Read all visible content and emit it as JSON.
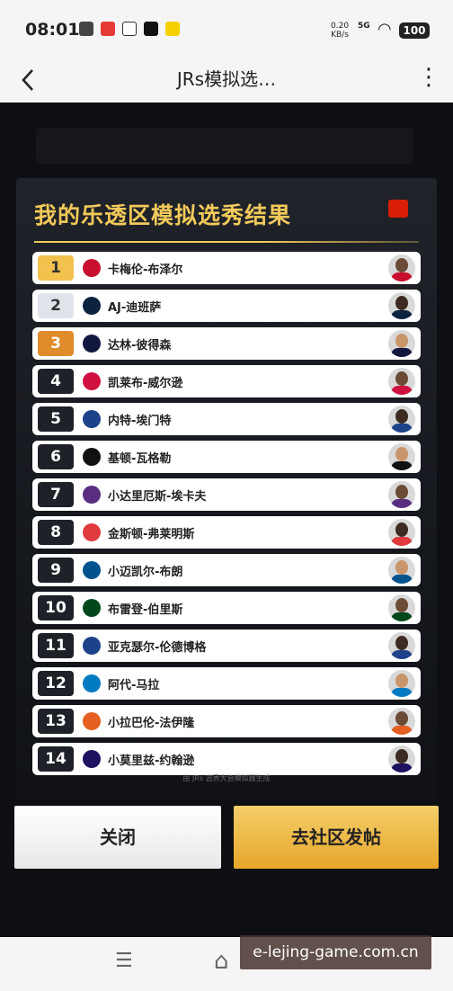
{
  "status_bar": {
    "time": "08:01",
    "net_speed_value": "0.20",
    "net_speed_unit": "KB/s",
    "signal": "5G",
    "battery": "100"
  },
  "nav": {
    "back_icon": "chevron-left-icon",
    "title": "JRs模拟选…",
    "more_icon": "more-vertical-icon"
  },
  "card": {
    "title": "我的乐透区模拟选秀结果",
    "footer_note": "由 JRs 选秀大会模拟器生成"
  },
  "picks": [
    {
      "num": "1",
      "name": "卡梅伦-布泽尔",
      "num_color": "#f2c14e",
      "num_text_color": "#333333",
      "team_color": "#c8102e"
    },
    {
      "num": "2",
      "name": "AJ-迪班萨",
      "num_color": "#dfe3ea",
      "num_text_color": "#333333",
      "team_color": "#0c2340"
    },
    {
      "num": "3",
      "name": "达林-彼得森",
      "num_color": "#e08b2c",
      "num_text_color": "#ffffff",
      "team_color": "#12173f"
    },
    {
      "num": "4",
      "name": "凯莱布-威尔逊",
      "num_color": "#1e2228",
      "num_text_color": "#ffffff",
      "team_color": "#ce1141"
    },
    {
      "num": "5",
      "name": "内特-埃门特",
      "num_color": "#1e2228",
      "num_text_color": "#ffffff",
      "team_color": "#1d428a"
    },
    {
      "num": "6",
      "name": "基顿-瓦格勒",
      "num_color": "#1e2228",
      "num_text_color": "#ffffff",
      "team_color": "#111111"
    },
    {
      "num": "7",
      "name": "小达里厄斯-埃卡夫",
      "num_color": "#1e2228",
      "num_text_color": "#ffffff",
      "team_color": "#5a2d81"
    },
    {
      "num": "8",
      "name": "金斯顿-弗莱明斯",
      "num_color": "#1e2228",
      "num_text_color": "#ffffff",
      "team_color": "#e03a3e"
    },
    {
      "num": "9",
      "name": "小迈凯尔-布朗",
      "num_color": "#1e2228",
      "num_text_color": "#ffffff",
      "team_color": "#00538c"
    },
    {
      "num": "10",
      "name": "布雷登-伯里斯",
      "num_color": "#1e2228",
      "num_text_color": "#ffffff",
      "team_color": "#00471b"
    },
    {
      "num": "11",
      "name": "亚克瑟尔-伦德博格",
      "num_color": "#1e2228",
      "num_text_color": "#ffffff",
      "team_color": "#1d428a"
    },
    {
      "num": "12",
      "name": "阿代-马拉",
      "num_color": "#1e2228",
      "num_text_color": "#ffffff",
      "team_color": "#007ac1"
    },
    {
      "num": "13",
      "name": "小拉巴伦-法伊隆",
      "num_color": "#1e2228",
      "num_text_color": "#ffffff",
      "team_color": "#e56020"
    },
    {
      "num": "14",
      "name": "小莫里兹-约翰逊",
      "num_color": "#1e2228",
      "num_text_color": "#ffffff",
      "team_color": "#1d1160"
    }
  ],
  "buttons": {
    "close": "关闭",
    "post": "去社区发帖"
  },
  "watermark": "e-lejing-game.com.cn"
}
